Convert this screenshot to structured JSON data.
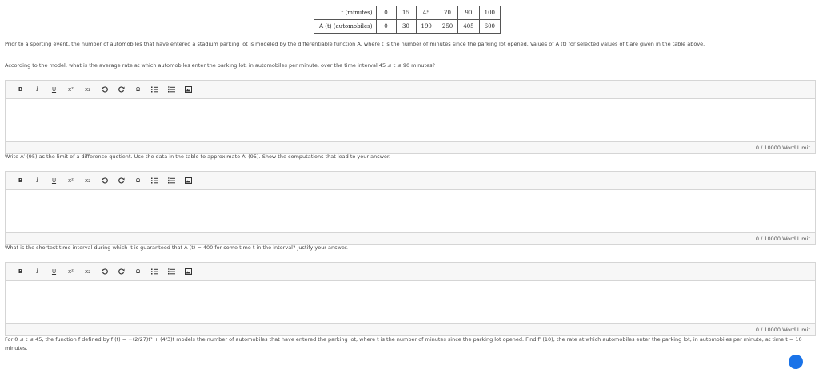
{
  "table": {
    "row1_label": "t (minutes)",
    "row2_label": "A (t) (automobiles)",
    "t_values": [
      "0",
      "15",
      "45",
      "70",
      "90",
      "100"
    ],
    "a_values": [
      "0",
      "30",
      "190",
      "250",
      "405",
      "600"
    ]
  },
  "intro": "Prior to a sporting event, the number of automobiles that have entered a stadium parking lot is modeled by the differentiable function A, where t is the number of minutes since the parking lot opened. Values of A (t) for selected values of t are given in the table above.",
  "questions": [
    {
      "text": "According to the model, what is the average rate at which automobiles enter the parking lot, in automobiles per minute, over the time interval 45 ≤ t ≤ 90 minutes?",
      "word_limit": "0 / 10000 Word Limit"
    },
    {
      "text": "Write A′ (95) as the limit of a difference quotient. Use the data in the table to approximate A′ (95). Show the computations that lead to your answer.",
      "word_limit": "0 / 10000 Word Limit"
    },
    {
      "text": "What is the shortest time interval during which it is guaranteed that A (t) = 400 for some time t in the interval? Justify your answer.",
      "word_limit": "0 / 10000 Word Limit"
    }
  ],
  "toolbar": {
    "bold": "B",
    "italic": "I",
    "underline": "U",
    "superscript": "x²",
    "subscript": "x₂",
    "omega": "Ω"
  },
  "last_question": "For 0 ≤ t ≤ 45, the function f defined by f (t) = −(2/27)t³ + (4/3)t models the number of automobiles that have entered the parking lot, where t is the number of minutes since the parking lot opened. Find f′ (10), the rate at which automobiles enter the parking lot, in automobiles per minute, at time t = 10 minutes."
}
